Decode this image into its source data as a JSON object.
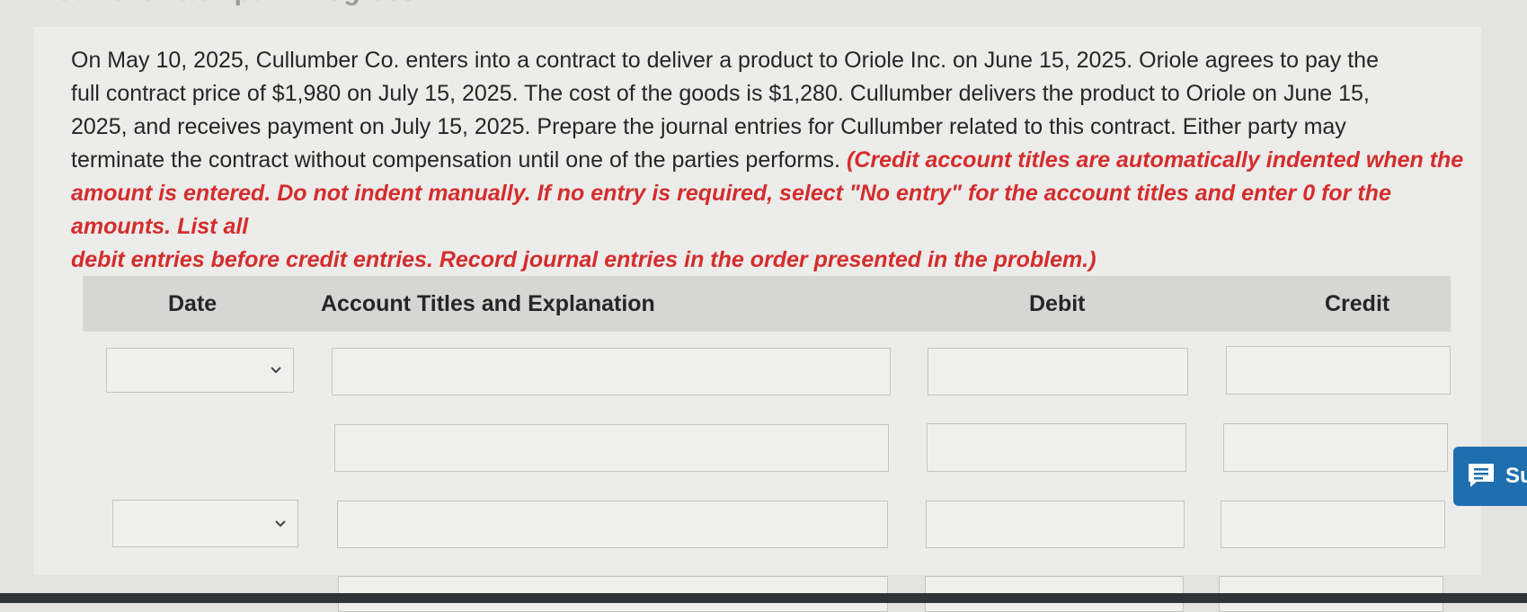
{
  "heading": "Current Attempt in Progress",
  "problem": {
    "line1": "On May 10, 2025, Cullumber Co. enters into a contract to deliver a product to Oriole Inc. on June 15, 2025. Oriole agrees to pay the",
    "line2": "full contract price of $1,980 on July 15, 2025. The cost of the goods is $1,280. Cullumber delivers the product to Oriole on June 15,",
    "line3": "2025, and receives payment on July 15, 2025. Prepare the journal entries for Cullumber related to this contract. Either party may",
    "line4_plain": "terminate the contract without compensation until one of the parties performs.",
    "line4_instr": "(Credit account titles are automatically indented when the",
    "line5": "amount is entered. Do not indent manually. If no entry is required, select \"No entry\" for the account titles and enter 0 for the amounts. List all",
    "line6": "debit entries before credit entries. Record journal entries in the order presented in the problem.)"
  },
  "table": {
    "headers": {
      "date": "Date",
      "account": "Account Titles and Explanation",
      "debit": "Debit",
      "credit": "Credit"
    },
    "rows": [
      {
        "date": "",
        "account": "",
        "debit": "",
        "credit": ""
      },
      {
        "account": "",
        "debit": "",
        "credit": ""
      },
      {
        "date": "",
        "account": "",
        "debit": "",
        "credit": ""
      },
      {
        "account": "",
        "debit": "",
        "credit": ""
      }
    ]
  },
  "support_button": {
    "label": "Su",
    "icon": "chat-icon",
    "color": "#1f6fae"
  },
  "colors": {
    "instruction_red": "#d42d2d",
    "header_bg": "#d6d6d4",
    "page_bg": "#ececea"
  }
}
